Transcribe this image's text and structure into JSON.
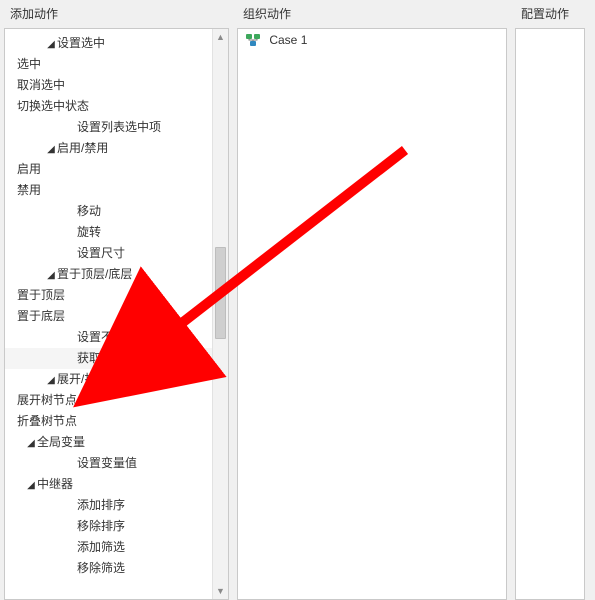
{
  "headers": {
    "add": "添加动作",
    "org": "组织动作",
    "cfg": "配置动作"
  },
  "tree": {
    "items": [
      {
        "indent": 1,
        "kind": "group",
        "label": "设置选中"
      },
      {
        "indent": 3,
        "kind": "leaf",
        "label": "选中"
      },
      {
        "indent": 3,
        "kind": "leaf",
        "label": "取消选中"
      },
      {
        "indent": 3,
        "kind": "leaf",
        "label": "切换选中状态"
      },
      {
        "indent": 2,
        "kind": "leaf",
        "label": "设置列表选中项"
      },
      {
        "indent": 1,
        "kind": "group",
        "label": "启用/禁用"
      },
      {
        "indent": 3,
        "kind": "leaf",
        "label": "启用"
      },
      {
        "indent": 3,
        "kind": "leaf",
        "label": "禁用"
      },
      {
        "indent": 2,
        "kind": "leaf",
        "label": "移动"
      },
      {
        "indent": 2,
        "kind": "leaf",
        "label": "旋转"
      },
      {
        "indent": 2,
        "kind": "leaf",
        "label": "设置尺寸"
      },
      {
        "indent": 1,
        "kind": "group",
        "label": "置于顶层/底层"
      },
      {
        "indent": 3,
        "kind": "leaf",
        "label": "置于顶层"
      },
      {
        "indent": 3,
        "kind": "leaf",
        "label": "置于底层"
      },
      {
        "indent": 2,
        "kind": "leaf",
        "label": "设置不透明"
      },
      {
        "indent": 2,
        "kind": "leaf",
        "label": "获取焦点",
        "highlight": true
      },
      {
        "indent": 1,
        "kind": "group",
        "label": "展开/折叠树节点"
      },
      {
        "indent": 3,
        "kind": "leaf",
        "label": "展开树节点"
      },
      {
        "indent": 3,
        "kind": "leaf",
        "label": "折叠树节点"
      },
      {
        "indent": 0,
        "kind": "group",
        "label": "全局变量"
      },
      {
        "indent": 2,
        "kind": "leaf",
        "label": "设置变量值"
      },
      {
        "indent": 0,
        "kind": "group",
        "label": "中继器"
      },
      {
        "indent": 2,
        "kind": "leaf",
        "label": "添加排序"
      },
      {
        "indent": 2,
        "kind": "leaf",
        "label": "移除排序"
      },
      {
        "indent": 2,
        "kind": "leaf",
        "label": "添加筛选"
      },
      {
        "indent": 2,
        "kind": "leaf",
        "label": "移除筛选"
      }
    ]
  },
  "org": {
    "case_label": "Case 1"
  },
  "annotation": {
    "arrow_color": "#ff0000"
  }
}
